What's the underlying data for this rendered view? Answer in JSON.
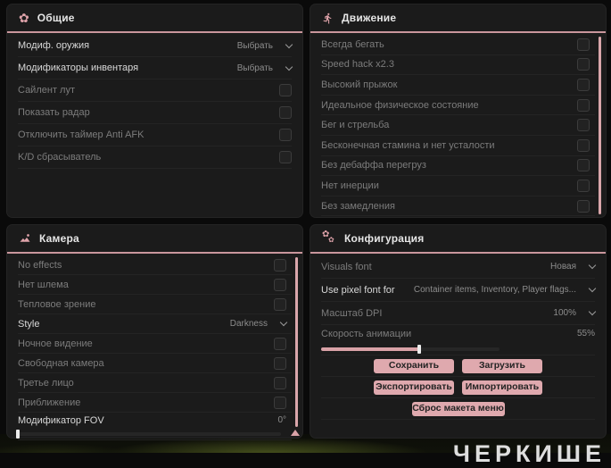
{
  "watermark": "ЧЕРКИШЕ",
  "colors": {
    "accent_pink": "#d9a2a7",
    "button_pink": "#dfa9ae",
    "panel_bg": "#1b1b1b",
    "page_bg": "#0a0a0a",
    "bright_text": "#d8d8d8",
    "dim_text": "#7c7c7c"
  },
  "panels": [
    {
      "id": "general",
      "title": "Общие",
      "icon": "flower-gear-icon",
      "items": [
        {
          "name": "weapon-mod",
          "label": "Модиф. оружия",
          "type": "dropdown",
          "value": "Выбрать",
          "bright": true
        },
        {
          "name": "inventory-modifiers",
          "label": "Модификаторы инвентаря",
          "type": "dropdown",
          "value": "Выбрать",
          "bright": true
        },
        {
          "name": "silent-loot",
          "label": "Сайлент лут",
          "type": "checkbox",
          "checked": false
        },
        {
          "name": "show-radar",
          "label": "Показать радар",
          "type": "checkbox",
          "checked": false
        },
        {
          "name": "disable-anti-afk-timer",
          "label": "Отключить таймер Anti AFK",
          "type": "checkbox",
          "checked": false
        },
        {
          "name": "kd-resetter",
          "label": "K/D сбрасыватель",
          "type": "checkbox",
          "checked": false
        }
      ]
    },
    {
      "id": "movement",
      "title": "Движение",
      "icon": "runner-icon",
      "items": [
        {
          "name": "always-run",
          "label": "Всегда бегать",
          "type": "checkbox",
          "checked": false
        },
        {
          "name": "speed-hack",
          "label": "Speed hack x2.3",
          "type": "checkbox",
          "checked": false
        },
        {
          "name": "high-jump",
          "label": "Высокий прыжок",
          "type": "checkbox",
          "checked": false
        },
        {
          "name": "perfect-physical-condition",
          "label": "Идеальное физическое состояние",
          "type": "checkbox",
          "checked": false
        },
        {
          "name": "run-and-shoot",
          "label": "Бег и стрельба",
          "type": "checkbox",
          "checked": false
        },
        {
          "name": "infinite-stamina",
          "label": "Бесконечная стамина и нет усталости",
          "type": "checkbox",
          "checked": false
        },
        {
          "name": "no-overload-debuff",
          "label": "Без дебаффа перегруз",
          "type": "checkbox",
          "checked": false
        },
        {
          "name": "no-inertia",
          "label": "Нет инерции",
          "type": "checkbox",
          "checked": false
        },
        {
          "name": "no-slowdown",
          "label": "Без замедления",
          "type": "checkbox",
          "checked": false
        }
      ]
    },
    {
      "id": "camera",
      "title": "Камера",
      "icon": "photo-icon",
      "items": [
        {
          "name": "no-effects",
          "label": "No effects",
          "type": "checkbox",
          "checked": false
        },
        {
          "name": "no-helmet",
          "label": "Нет шлема",
          "type": "checkbox",
          "checked": false
        },
        {
          "name": "thermal-vision",
          "label": "Тепловое зрение",
          "type": "checkbox",
          "checked": false
        },
        {
          "name": "style",
          "label": "Style",
          "type": "dropdown",
          "value": "Darkness",
          "bright": true
        },
        {
          "name": "night-vision",
          "label": "Ночное видение",
          "type": "checkbox",
          "checked": false
        },
        {
          "name": "free-camera",
          "label": "Свободная камера",
          "type": "checkbox",
          "checked": false
        },
        {
          "name": "third-person",
          "label": "Третье лицо",
          "type": "checkbox",
          "checked": false
        },
        {
          "name": "zoom",
          "label": "Приближение",
          "type": "checkbox",
          "checked": false
        },
        {
          "name": "fov-modifier",
          "label": "Модификатор FOV",
          "type": "slider",
          "value": "0°",
          "percent": 0,
          "track": 295,
          "bright": true
        }
      ]
    },
    {
      "id": "config",
      "title": "Конфигурация",
      "icon": "gears-icon",
      "items": [
        {
          "name": "visuals-font",
          "label": "Visuals font",
          "type": "dropdown",
          "value": "Новая",
          "bright": false
        },
        {
          "name": "use-pixel-font-for",
          "label": "Use pixel font for",
          "type": "dropdown",
          "value": "Container items, Inventory, Player flags...",
          "bright": true
        },
        {
          "name": "dpi-scale",
          "label": "Масштаб DPI",
          "type": "dropdown",
          "value": "100%",
          "bright": false
        },
        {
          "name": "animation-speed",
          "label": "Скорость анимации",
          "type": "slider",
          "value": "55%",
          "percent": 55,
          "track": 200,
          "bright": false
        }
      ],
      "button_rows": [
        [
          {
            "name": "save-button",
            "label": "Сохранить"
          },
          {
            "name": "load-button",
            "label": "Загрузить"
          }
        ],
        [
          {
            "name": "export-button",
            "label": "Экспортировать"
          },
          {
            "name": "import-button",
            "label": "Импортировать"
          }
        ],
        [
          {
            "name": "reset-menu-layout-button",
            "label": "Сброс макета меню",
            "wide": true
          }
        ]
      ]
    }
  ]
}
